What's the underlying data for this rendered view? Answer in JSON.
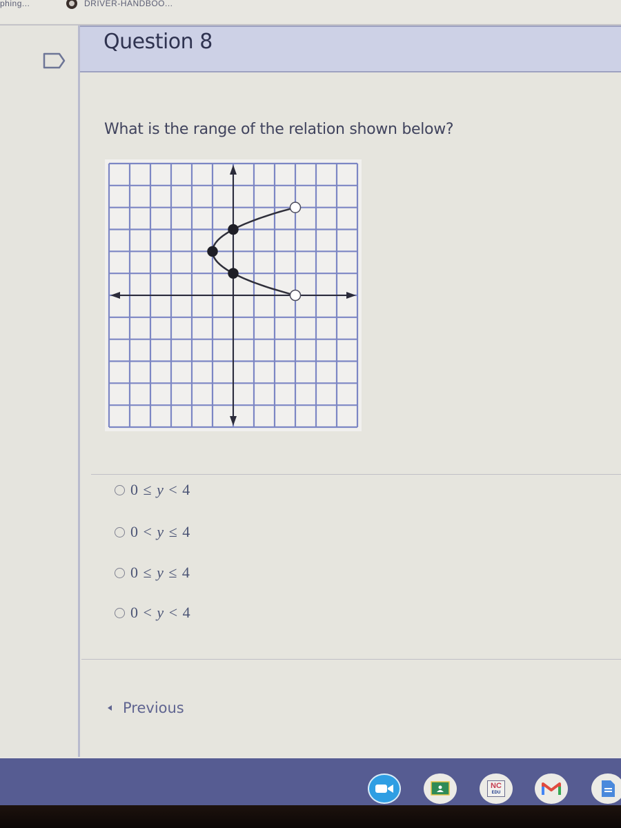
{
  "browser": {
    "bookmarks": [
      {
        "label": "phing...",
        "icon": "bookmark-favicon"
      },
      {
        "label": "DRIVER-HANDBOO...",
        "icon": "globe-icon"
      }
    ]
  },
  "sidebar": {
    "flag_icon": "flag-outline-icon",
    "flag_checked": false
  },
  "question": {
    "title": "Question 8",
    "prompt": "What is the range of the relation shown below?",
    "choices": [
      {
        "left": "0 ≤ ",
        "var": "y",
        "right": " < 4",
        "selected": false
      },
      {
        "left": "0 < ",
        "var": "y",
        "right": " ≤ 4",
        "selected": false
      },
      {
        "left": "0 ≤ ",
        "var": "y",
        "right": " ≤ 4",
        "selected": false
      },
      {
        "left": "0 < ",
        "var": "y",
        "right": " < 4",
        "selected": false
      }
    ],
    "previous_label": "Previous"
  },
  "chart_data": {
    "type": "line",
    "title": "",
    "xlabel": "",
    "ylabel": "",
    "xlim": [
      -6,
      6
    ],
    "ylim": [
      -6,
      6
    ],
    "grid": true,
    "grid_step": 1,
    "axes_arrows": true,
    "curve": {
      "description": "sideways parabola x = (y-2)^2 - 1 for 0 < y < 4",
      "points": [
        [
          3,
          0
        ],
        [
          0,
          1
        ],
        [
          -1,
          2
        ],
        [
          0,
          3
        ],
        [
          3,
          4
        ]
      ]
    },
    "points": [
      {
        "x": -1,
        "y": 2,
        "style": "filled"
      },
      {
        "x": 0,
        "y": 1,
        "style": "filled"
      },
      {
        "x": 0,
        "y": 3,
        "style": "filled"
      },
      {
        "x": 3,
        "y": 0,
        "style": "open"
      },
      {
        "x": 3,
        "y": 4,
        "style": "open"
      }
    ],
    "colors": {
      "grid": "#7c86c4",
      "axis": "#2b2b3a",
      "curve": "#2f2f3a"
    }
  },
  "shelf": {
    "apps": [
      {
        "name": "Zoom",
        "icon": "video-camera-icon"
      },
      {
        "name": "Google Classroom",
        "icon": "classroom-icon"
      },
      {
        "name": "NCEdCloud",
        "icon": "nc-icon",
        "text_top": "NC",
        "text_bottom": "EDU"
      },
      {
        "name": "Gmail",
        "icon": "gmail-icon"
      },
      {
        "name": "Google Docs",
        "icon": "docs-icon"
      }
    ]
  }
}
